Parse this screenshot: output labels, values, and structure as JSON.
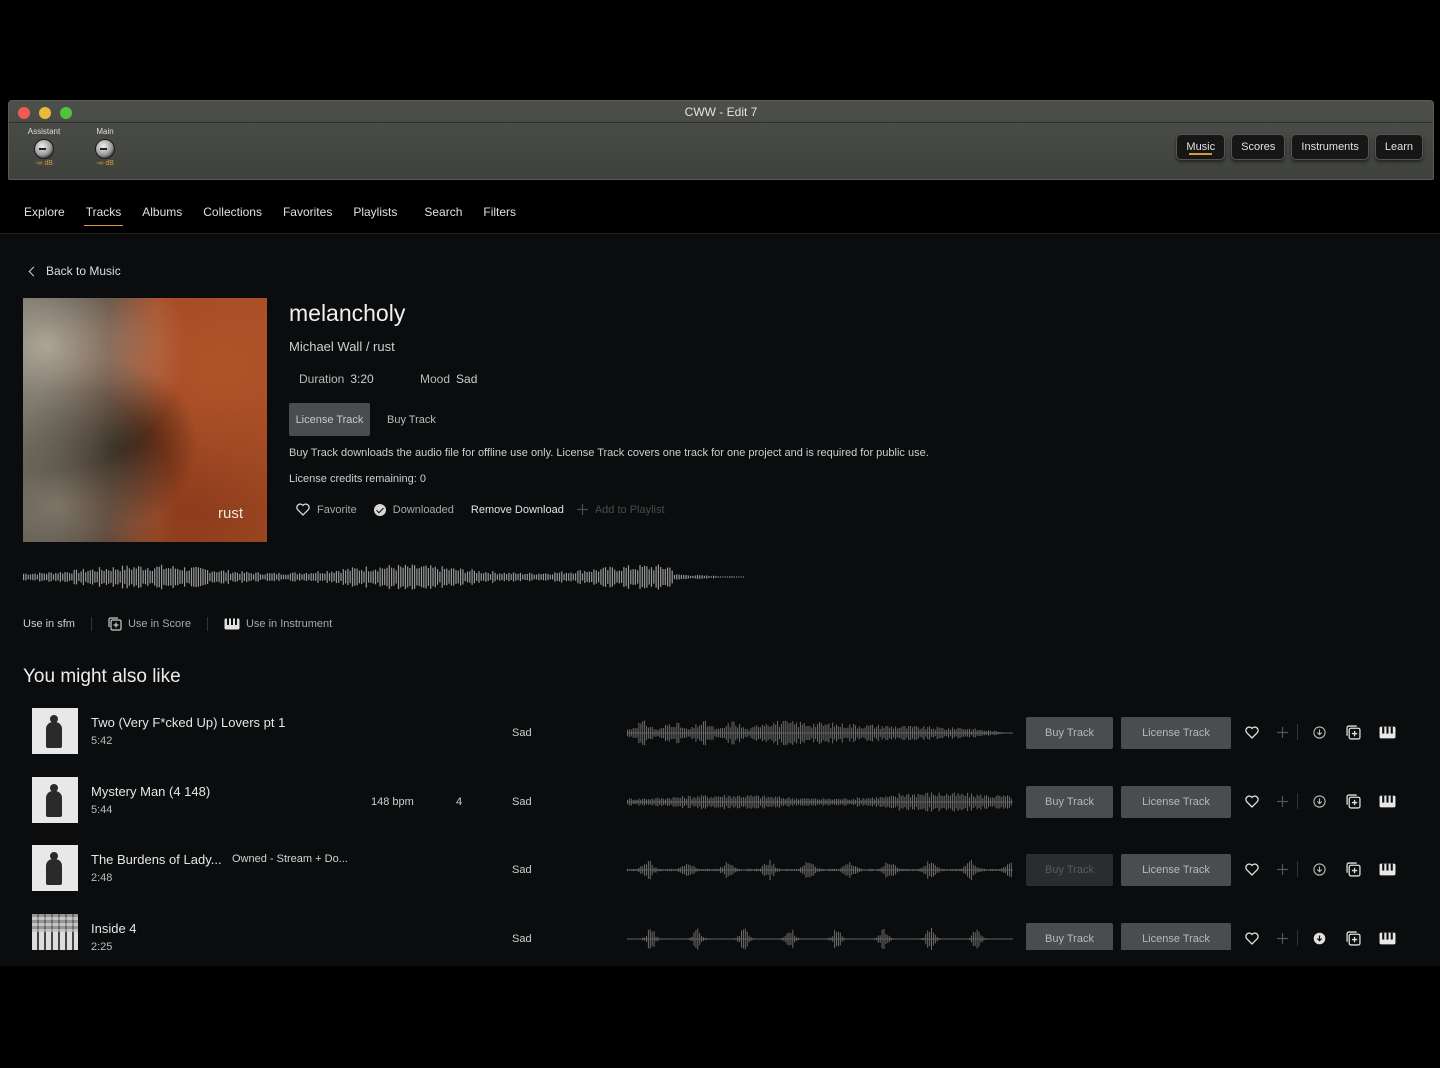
{
  "window": {
    "title": "CWW - Edit 7",
    "knobs": [
      {
        "label": "Assistant",
        "db": "-∞ dB"
      },
      {
        "label": "Main",
        "db": "-∞ dB"
      }
    ],
    "topnav": [
      "Music",
      "Scores",
      "Instruments",
      "Learn"
    ],
    "topnav_active": "Music"
  },
  "nav": {
    "items": [
      "Explore",
      "Tracks",
      "Albums",
      "Collections",
      "Favorites",
      "Playlists",
      "Search",
      "Filters"
    ],
    "active": "Tracks"
  },
  "back_label": "Back to Music",
  "track": {
    "cover_label": "rust",
    "title": "melancholy",
    "artist_album": "Michael Wall / rust",
    "duration_label": "Duration",
    "duration": "3:20",
    "mood_label": "Mood",
    "mood": "Sad",
    "license_button": "License Track",
    "buy_button": "Buy Track",
    "description": "Buy Track downloads the audio file for offline use only. License Track covers one track for one project and is required for public use.",
    "credits": "License credits remaining: 0",
    "actions": {
      "favorite": "Favorite",
      "downloaded": "Downloaded",
      "remove_download": "Remove Download",
      "add_to_playlist": "Add to Playlist"
    }
  },
  "use_row": {
    "use_in_sfm": "Use in sfm",
    "use_in_score": "Use in Score",
    "use_in_instrument": "Use in Instrument"
  },
  "recommendations": {
    "title": "You might also like",
    "rows": [
      {
        "title": "Two (Very F*cked Up) Lovers pt 1",
        "time": "5:42",
        "badge": "",
        "bpm": "",
        "key": "",
        "mood": "Sad",
        "buy": "Buy Track",
        "license": "License Track",
        "buy_disabled": false,
        "downloaded": false,
        "thumb": "figure"
      },
      {
        "title": "Mystery Man (4 148)",
        "time": "5:44",
        "badge": "",
        "bpm": "148 bpm",
        "key": "4",
        "mood": "Sad",
        "buy": "Buy Track",
        "license": "License Track",
        "buy_disabled": false,
        "downloaded": false,
        "thumb": "figure"
      },
      {
        "title": "The Burdens of Lady...",
        "time": "2:48",
        "badge": "Owned - Stream + Do...",
        "bpm": "",
        "key": "",
        "mood": "Sad",
        "buy": "Buy Track",
        "license": "License Track",
        "buy_disabled": true,
        "downloaded": false,
        "thumb": "figure"
      },
      {
        "title": "Inside 4",
        "time": "2:25",
        "badge": "",
        "bpm": "",
        "key": "",
        "mood": "Sad",
        "buy": "Buy Track",
        "license": "License Track",
        "buy_disabled": false,
        "downloaded": true,
        "thumb": "piano"
      }
    ]
  },
  "colors": {
    "accent": "#d69b3a",
    "button": "#4a4c4e",
    "background": "#0a0c0d"
  }
}
